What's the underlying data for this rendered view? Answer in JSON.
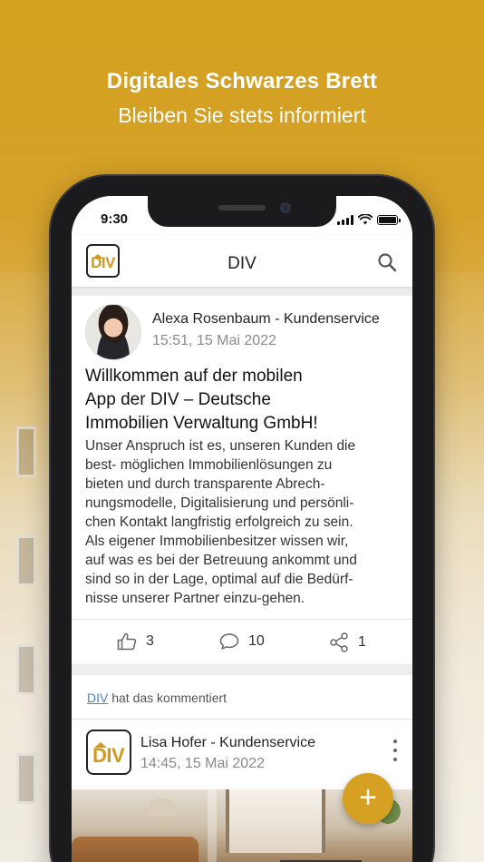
{
  "promo": {
    "headline": "Digitales Schwarzes Brett",
    "subline": "Bleiben Sie stets informiert"
  },
  "statusbar": {
    "time": "9:30",
    "icons": [
      "signal-icon",
      "wifi-icon",
      "battery-icon"
    ]
  },
  "appbar": {
    "logo_text": "DIV",
    "title": "DIV",
    "search_icon": "search-icon"
  },
  "post": {
    "author": "Alexa Rosenbaum - Kundenservice",
    "timestamp": "15:51, 15 Mai 2022",
    "title_lines": [
      "Willkommen auf der mobilen",
      "App der DIV – Deutsche",
      "Immobilien Verwaltung GmbH!"
    ],
    "body_lines": [
      "Unser Anspruch ist es, unseren Kunden die",
      "best- möglichen Immobilienlösungen zu",
      "bieten und durch transparente Abrech-",
      "nungsmodelle, Digitalisierung und persönli-",
      "chen Kontakt langfristig erfolgreich zu sein.",
      "Als eigener Immobilienbesitzer wissen wir,",
      "auf was es bei der Betreuung ankommt und",
      "sind so in der Lage, optimal auf die Bedürf-",
      "nisse unserer Partner einzu-gehen."
    ],
    "likes": "3",
    "comments": "10",
    "shares": "1"
  },
  "comment_card": {
    "link": "DIV",
    "text": " hat das kommentiert",
    "logo_text": "DIV",
    "author": "Lisa Hofer - Kundenservice",
    "timestamp": "14:45, 15 Mai 2022"
  },
  "colors": {
    "accent": "#d6a023",
    "link": "#4b84c8"
  },
  "fab": {
    "label": "+"
  }
}
